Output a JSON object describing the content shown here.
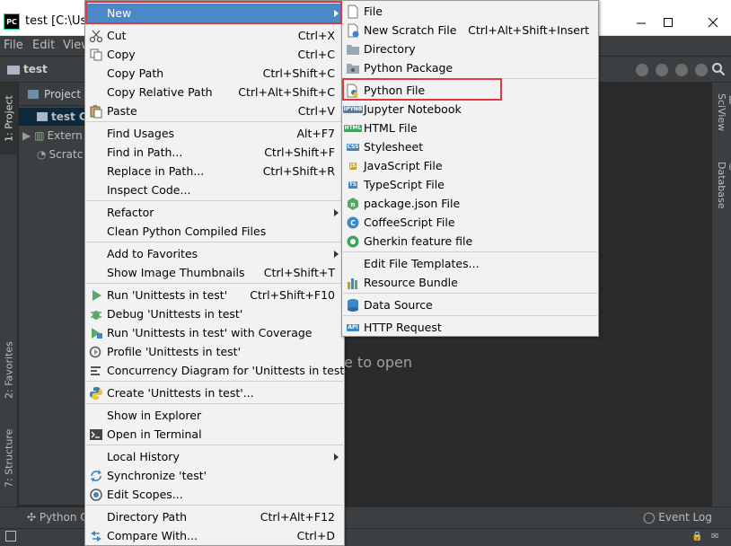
{
  "window": {
    "title": "test [C:\\Use"
  },
  "colors": {
    "menu_bg": "#f2f2f2",
    "highlight": "#4a88c7",
    "red_outline": "#e0383e",
    "ide_dark": "#2b2b2b",
    "ide_panel": "#3c3f41"
  },
  "menubar": [
    "File",
    "Edit",
    "View"
  ],
  "navbar": {
    "crumb": "test"
  },
  "left_tabs": [
    "1: Project",
    "2: Favorites",
    "7: Structure"
  ],
  "right_tabs": [
    "SciView",
    "Database"
  ],
  "project_panel": {
    "header": "Project",
    "rows": [
      "test C",
      "Extern",
      "Scratc"
    ]
  },
  "editor": {
    "hint": "e to open"
  },
  "bottom": {
    "python_console": "Python C",
    "event_log": "Event Log"
  },
  "context_menu": {
    "items": [
      {
        "label": "New",
        "shortcut": "",
        "icon": "none",
        "submenu": true,
        "highlighted": true
      },
      {
        "label": "Cut",
        "shortcut": "Ctrl+X",
        "icon": "scissors-icon"
      },
      {
        "label": "Copy",
        "shortcut": "Ctrl+C",
        "icon": "copy-icon"
      },
      {
        "label": "Copy Path",
        "shortcut": "Ctrl+Shift+C",
        "icon": "none"
      },
      {
        "label": "Copy Relative Path",
        "shortcut": "Ctrl+Alt+Shift+C",
        "icon": "none"
      },
      {
        "label": "Paste",
        "shortcut": "Ctrl+V",
        "icon": "paste-icon"
      },
      {
        "label": "Find Usages",
        "shortcut": "Alt+F7",
        "icon": "none"
      },
      {
        "label": "Find in Path...",
        "shortcut": "Ctrl+Shift+F",
        "icon": "none"
      },
      {
        "label": "Replace in Path...",
        "shortcut": "Ctrl+Shift+R",
        "icon": "none"
      },
      {
        "label": "Inspect Code...",
        "shortcut": "",
        "icon": "none"
      },
      {
        "label": "Refactor",
        "shortcut": "",
        "icon": "none",
        "submenu": true
      },
      {
        "label": "Clean Python Compiled Files",
        "shortcut": "",
        "icon": "none"
      },
      {
        "label": "Add to Favorites",
        "shortcut": "",
        "icon": "none",
        "submenu": true
      },
      {
        "label": "Show Image Thumbnails",
        "shortcut": "Ctrl+Shift+T",
        "icon": "none"
      },
      {
        "label": "Run 'Unittests in test'",
        "shortcut": "Ctrl+Shift+F10",
        "icon": "run-icon"
      },
      {
        "label": "Debug 'Unittests in test'",
        "shortcut": "",
        "icon": "debug-icon"
      },
      {
        "label": "Run 'Unittests in test' with Coverage",
        "shortcut": "",
        "icon": "coverage-icon"
      },
      {
        "label": "Profile 'Unittests in test'",
        "shortcut": "",
        "icon": "profile-icon"
      },
      {
        "label": "Concurrency Diagram for 'Unittests in test'",
        "shortcut": "",
        "icon": "concurrency-icon"
      },
      {
        "label": "Create 'Unittests in test'...",
        "shortcut": "",
        "icon": "python-icon"
      },
      {
        "label": "Show in Explorer",
        "shortcut": "",
        "icon": "none"
      },
      {
        "label": "Open in Terminal",
        "shortcut": "",
        "icon": "terminal-icon"
      },
      {
        "label": "Local History",
        "shortcut": "",
        "icon": "none",
        "submenu": true
      },
      {
        "label": "Synchronize 'test'",
        "shortcut": "",
        "icon": "sync-icon"
      },
      {
        "label": "Edit Scopes...",
        "shortcut": "",
        "icon": "scopes-icon"
      },
      {
        "label": "Directory Path",
        "shortcut": "Ctrl+Alt+F12",
        "icon": "none"
      },
      {
        "label": "Compare With...",
        "shortcut": "Ctrl+D",
        "icon": "compare-icon"
      }
    ]
  },
  "new_submenu": {
    "items": [
      {
        "label": "File",
        "shortcut": "",
        "icon": "file-icon"
      },
      {
        "label": "New Scratch File",
        "shortcut": "Ctrl+Alt+Shift+Insert",
        "icon": "scratch-file-icon"
      },
      {
        "label": "Directory",
        "shortcut": "",
        "icon": "folder-icon"
      },
      {
        "label": "Python Package",
        "shortcut": "",
        "icon": "package-icon"
      },
      {
        "label": "Python File",
        "shortcut": "",
        "icon": "python-file-icon"
      },
      {
        "label": "Jupyter Notebook",
        "shortcut": "",
        "icon": "jupyter-icon"
      },
      {
        "label": "HTML File",
        "shortcut": "",
        "icon": "html-icon"
      },
      {
        "label": "Stylesheet",
        "shortcut": "",
        "icon": "css-icon"
      },
      {
        "label": "JavaScript File",
        "shortcut": "",
        "icon": "js-icon"
      },
      {
        "label": "TypeScript File",
        "shortcut": "",
        "icon": "ts-icon"
      },
      {
        "label": "package.json File",
        "shortcut": "",
        "icon": "npm-icon"
      },
      {
        "label": "CoffeeScript File",
        "shortcut": "",
        "icon": "coffee-icon"
      },
      {
        "label": "Gherkin feature file",
        "shortcut": "",
        "icon": "gherkin-icon"
      },
      {
        "label": "Edit File Templates...",
        "shortcut": "",
        "icon": "none"
      },
      {
        "label": "Resource Bundle",
        "shortcut": "",
        "icon": "bundle-icon"
      },
      {
        "label": "Data Source",
        "shortcut": "",
        "icon": "datasource-icon"
      },
      {
        "label": "HTTP Request",
        "shortcut": "",
        "icon": "http-icon"
      }
    ]
  }
}
